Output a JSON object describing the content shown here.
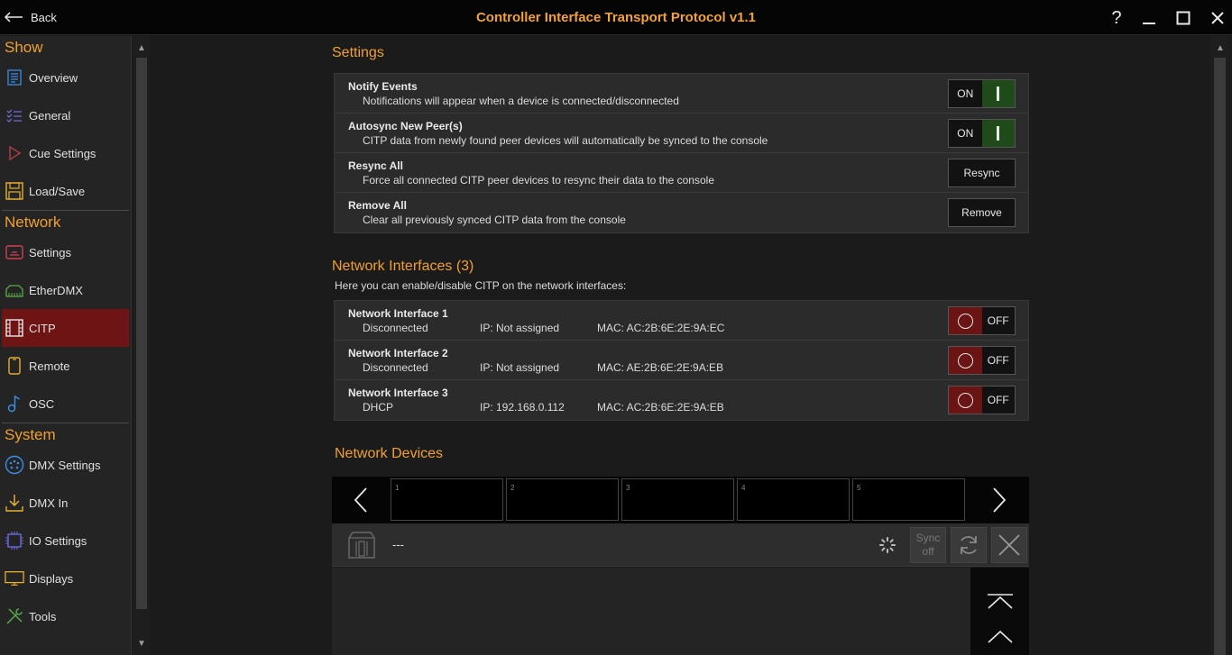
{
  "titlebar": {
    "back_label": "Back",
    "title": "Controller Interface Transport Protocol v1.1",
    "help_label": "?"
  },
  "sidebar": {
    "sections": [
      {
        "label": "Show",
        "items": [
          {
            "label": "Overview",
            "icon": "list-icon"
          },
          {
            "label": "General",
            "icon": "checklist-icon"
          },
          {
            "label": "Cue Settings",
            "icon": "play-icon"
          },
          {
            "label": "Load/Save",
            "icon": "save-icon"
          }
        ]
      },
      {
        "label": "Network",
        "items": [
          {
            "label": "Settings",
            "icon": "network-settings-icon"
          },
          {
            "label": "EtherDMX",
            "icon": "ethernet-icon"
          },
          {
            "label": "CITP",
            "icon": "film-icon",
            "active": true
          },
          {
            "label": "Remote",
            "icon": "phone-icon"
          },
          {
            "label": "OSC",
            "icon": "music-note-icon"
          }
        ]
      },
      {
        "label": "System",
        "items": [
          {
            "label": "DMX Settings",
            "icon": "dmx-connector-icon"
          },
          {
            "label": "DMX In",
            "icon": "download-icon"
          },
          {
            "label": "IO Settings",
            "icon": "chip-icon"
          },
          {
            "label": "Displays",
            "icon": "monitor-icon"
          },
          {
            "label": "Tools",
            "icon": "tools-icon"
          }
        ]
      }
    ]
  },
  "settings": {
    "heading": "Settings",
    "rows": [
      {
        "title": "Notify Events",
        "desc": "Notifications will appear when a device is connected/disconnected",
        "control": "toggle",
        "state": "ON"
      },
      {
        "title": "Autosync New Peer(s)",
        "desc": "CITP data from newly found peer devices will automatically be synced to the console",
        "control": "toggle",
        "state": "ON"
      },
      {
        "title": "Resync All",
        "desc": "Force all connected CITP peer devices to resync their data to the console",
        "control": "button",
        "button_label": "Resync"
      },
      {
        "title": "Remove All",
        "desc": "Clear all previously synced CITP data from the console",
        "control": "button",
        "button_label": "Remove"
      }
    ]
  },
  "interfaces": {
    "heading": "Network Interfaces (3)",
    "description": "Here you can enable/disable CITP on the network interfaces:",
    "rows": [
      {
        "title": "Network Interface 1",
        "status": "Disconnected",
        "ip": "IP: Not assigned",
        "mac": "MAC: AC:2B:6E:2E:9A:EC",
        "state": "OFF"
      },
      {
        "title": "Network Interface 2",
        "status": "Disconnected",
        "ip": "IP: Not assigned",
        "mac": "MAC: AE:2B:6E:2E:9A:EB",
        "state": "OFF"
      },
      {
        "title": "Network Interface 3",
        "status": "DHCP",
        "ip": "IP: 192.168.0.112",
        "mac": "MAC: AC:2B:6E:2E:9A:EB",
        "state": "OFF"
      }
    ]
  },
  "devices": {
    "heading": "Network Devices",
    "slots": [
      "1",
      "2",
      "3",
      "4",
      "5"
    ],
    "selected_name": "---",
    "sync_label_line1": "Sync",
    "sync_label_line2": "off"
  },
  "colors": {
    "accent": "#f0a030",
    "active_nav": "#6e1414",
    "toggle_on": "#1f4a1a",
    "toggle_off": "#6a1414"
  }
}
